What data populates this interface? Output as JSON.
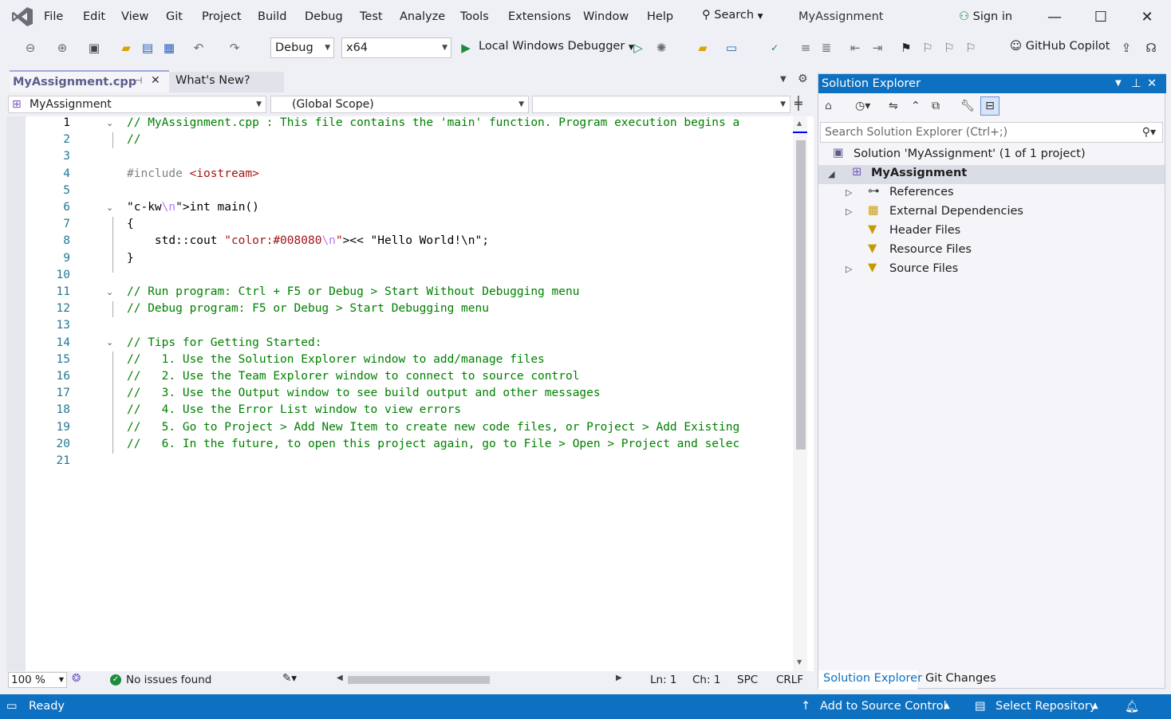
{
  "menu": [
    "File",
    "Edit",
    "View",
    "Git",
    "Project",
    "Build",
    "Debug",
    "Test",
    "Analyze",
    "Tools",
    "Extensions",
    "Window",
    "Help"
  ],
  "title_search": "Search",
  "solution_title": "MyAssignment",
  "sign_in": "Sign in",
  "toolbar": {
    "config": "Debug",
    "platform": "x64",
    "run_target": "Local Windows Debugger",
    "copilot": "GitHub Copilot"
  },
  "tabs": [
    {
      "label": "MyAssignment.cpp",
      "active": true
    },
    {
      "label": "What's New?",
      "active": false
    }
  ],
  "navbar": {
    "project": "MyAssignment",
    "scope": "(Global Scope)",
    "member": ""
  },
  "editor": {
    "line_numbers": [
      "1",
      "2",
      "3",
      "4",
      "5",
      "6",
      "7",
      "8",
      "9",
      "10",
      "11",
      "12",
      "13",
      "14",
      "15",
      "16",
      "17",
      "18",
      "19",
      "20",
      "21"
    ],
    "lines": [
      "// MyAssignment.cpp : This file contains the 'main' function. Program execution begins a",
      "//",
      "",
      "#include <iostream>",
      "",
      "int main()",
      "{",
      "    std::cout << \"Hello World!\\n\";",
      "}",
      "",
      "// Run program: Ctrl + F5 or Debug > Start Without Debugging menu",
      "// Debug program: F5 or Debug > Start Debugging menu",
      "",
      "// Tips for Getting Started:",
      "//   1. Use the Solution Explorer window to add/manage files",
      "//   2. Use the Team Explorer window to connect to source control",
      "//   3. Use the Output window to see build output and other messages",
      "//   4. Use the Error List window to view errors",
      "//   5. Go to Project > Add New Item to create new code files, or Project > Add Existing",
      "//   6. In the future, to open this project again, go to File > Open > Project and selec",
      ""
    ]
  },
  "editor_status": {
    "zoom": "100 %",
    "issues": "No issues found",
    "line": "Ln: 1",
    "col": "Ch: 1",
    "whitespace": "SPC",
    "line_ending": "CRLF"
  },
  "solution_explorer": {
    "title": "Solution Explorer",
    "search_placeholder": "Search Solution Explorer (Ctrl+;)",
    "solution": "Solution 'MyAssignment' (1 of 1 project)",
    "project": "MyAssignment",
    "items": [
      "References",
      "External Dependencies",
      "Header Files",
      "Resource Files",
      "Source Files"
    ],
    "bottom_tabs": [
      "Solution Explorer",
      "Git Changes"
    ]
  },
  "statusbar": {
    "ready": "Ready",
    "add_source": "Add to Source Control",
    "select_repo": "Select Repository"
  },
  "colors": {
    "accent": "#0e70c0",
    "comment": "#008000",
    "keyword": "#0000ff",
    "string": "#a31515"
  }
}
